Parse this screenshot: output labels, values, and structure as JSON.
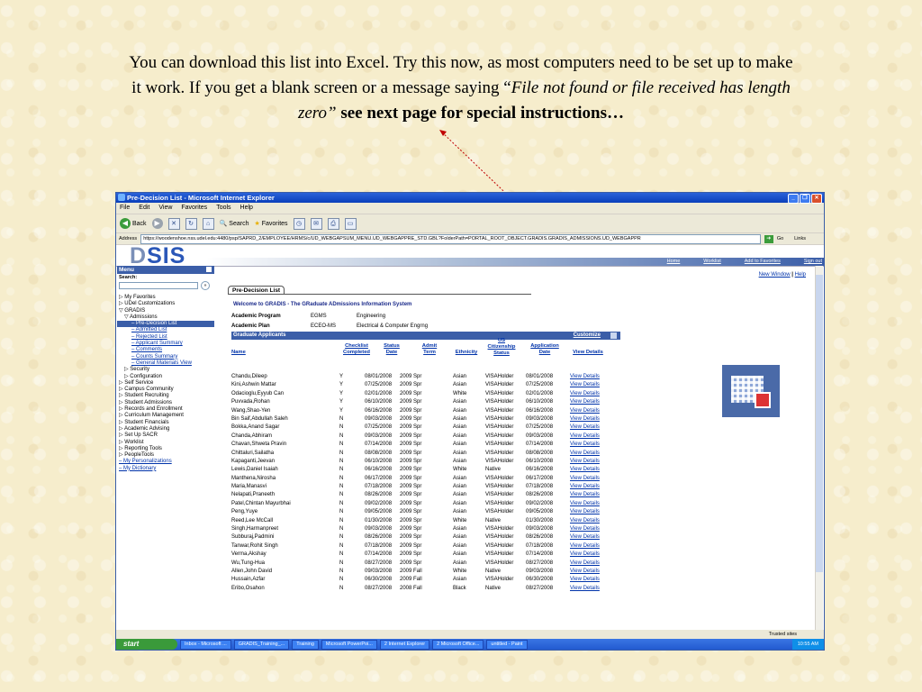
{
  "slide": {
    "line1": "You can download this list into Excel.  Try this now, as most computers need to be set up to make",
    "line2a": "it work.  If you get a blank screen or a message saying ",
    "quote_open": "“",
    "italic_a": "File not found or file received has length",
    "italic_b": "zero”",
    "bold": " see next page for special instructions…"
  },
  "window": {
    "title": "Pre-Decision List - Microsoft Internet Explorer",
    "menu": [
      "File",
      "Edit",
      "View",
      "Favorites",
      "Tools",
      "Help"
    ],
    "toolbar": {
      "back": "Back",
      "search": "Search",
      "favorites": "Favorites"
    },
    "address_label": "Address",
    "address": "https://woodenshoe.nss.udel.edu:4480/psp/SAPRD_2/EMPLOYEE/HRMS/c/UD_WEBGAPSUM_MENU.UD_WEBGAPPRE_STD.GBL?FolderPath=PORTAL_ROOT_OBJECT.GRADIS.GRADIS_ADMISSIONS.UD_WEBGAPPR",
    "go": "Go",
    "links": "Links"
  },
  "header": {
    "logo_a": "D",
    "logo_b": "SIS",
    "nav": [
      "Home",
      "Worklist",
      "Add to Favorites",
      "Sign out"
    ]
  },
  "sidebar": {
    "title": "Menu",
    "search_label": "Search:",
    "items": [
      {
        "label": "▷ My Favorites",
        "lvl": "l0"
      },
      {
        "label": "▷ UDel Customizations",
        "lvl": "l0"
      },
      {
        "label": "▽ GRADIS",
        "lvl": "l0"
      },
      {
        "label": "▽ Admissions",
        "lvl": "l1"
      },
      {
        "label": "– Pre-Decision List",
        "lvl": "l2 sel"
      },
      {
        "label": "– Admitted List",
        "lvl": "l2"
      },
      {
        "label": "– Rejected List",
        "lvl": "l2"
      },
      {
        "label": "– Applicant Summary",
        "lvl": "l2"
      },
      {
        "label": "– Comments",
        "lvl": "l2"
      },
      {
        "label": "– Counts Summary",
        "lvl": "l2"
      },
      {
        "label": "– General Materials View",
        "lvl": "l2"
      },
      {
        "label": "▷ Security",
        "lvl": "l1"
      },
      {
        "label": "▷ Configuration",
        "lvl": "l1"
      },
      {
        "label": "▷ Self Service",
        "lvl": "l0"
      },
      {
        "label": "▷ Campus Community",
        "lvl": "l0"
      },
      {
        "label": "▷ Student Recruiting",
        "lvl": "l0"
      },
      {
        "label": "▷ Student Admissions",
        "lvl": "l0"
      },
      {
        "label": "▷ Records and Enrollment",
        "lvl": "l0"
      },
      {
        "label": "▷ Curriculum Management",
        "lvl": "l0"
      },
      {
        "label": "▷ Student Financials",
        "lvl": "l0"
      },
      {
        "label": "▷ Academic Advising",
        "lvl": "l0"
      },
      {
        "label": "▷ Set Up SACR",
        "lvl": "l0"
      },
      {
        "label": "▷ Worklist",
        "lvl": "l0"
      },
      {
        "label": "▷ Reporting Tools",
        "lvl": "l0"
      },
      {
        "label": "▷ PeopleTools",
        "lvl": "l0"
      },
      {
        "label": "– My Personalizations",
        "lvl": "link"
      },
      {
        "label": "– My Dictionary",
        "lvl": "link"
      }
    ]
  },
  "content": {
    "new_window": "New Window",
    "sep": "|",
    "help": "Help",
    "tab": "Pre-Decision List",
    "welcome": "Welcome to GRADIS - The GRaduate ADmissions Information System",
    "program_label": "Academic Program",
    "program_code": "EGMS",
    "program_name": "Engineering",
    "plan_label": "Academic Plan",
    "plan_code": "ECEO-MS",
    "plan_name": "Electrical & Computer Engrng",
    "grid_title": "Graduate Applicants",
    "customize": "Customize",
    "columns": [
      "Name",
      "Checklist Completed",
      "Status Date",
      "Admit Term",
      "Ethnicity",
      "US Citizenship Status",
      "Application Date",
      "View Details"
    ],
    "rows": [
      [
        "Chandu,Dileep",
        "Y",
        "08/01/2008",
        "2009 Spr",
        "Asian",
        "VISAHolder",
        "08/01/2008",
        "View Details"
      ],
      [
        "Kini,Ashwin Mattar",
        "Y",
        "07/25/2008",
        "2009 Spr",
        "Asian",
        "VISAHolder",
        "07/25/2008",
        "View Details"
      ],
      [
        "Odacioglu,Eyyub Can",
        "Y",
        "02/01/2008",
        "2009 Spr",
        "White",
        "VISAHolder",
        "02/01/2008",
        "View Details"
      ],
      [
        "Puvvada,Rohan",
        "Y",
        "06/10/2008",
        "2009 Spr",
        "Asian",
        "VISAHolder",
        "06/10/2008",
        "View Details"
      ],
      [
        "Wang,Shao-Yen",
        "Y",
        "06/16/2008",
        "2009 Spr",
        "Asian",
        "VISAHolder",
        "06/16/2008",
        "View Details"
      ],
      [
        "Bin Saif,Abdullah Saleh",
        "N",
        "09/03/2008",
        "2009 Spr",
        "Asian",
        "VISAHolder",
        "09/03/2008",
        "View Details"
      ],
      [
        "Bokka,Anand Sagar",
        "N",
        "07/25/2008",
        "2009 Spr",
        "Asian",
        "VISAHolder",
        "07/25/2008",
        "View Details"
      ],
      [
        "Chanda,Abhiram",
        "N",
        "09/03/2008",
        "2009 Spr",
        "Asian",
        "VISAHolder",
        "09/03/2008",
        "View Details"
      ],
      [
        "Chavan,Shweta Pravin",
        "N",
        "07/14/2008",
        "2009 Spr",
        "Asian",
        "VISAHolder",
        "07/14/2008",
        "View Details"
      ],
      [
        "Chittaluri,Sailatha",
        "N",
        "08/08/2008",
        "2009 Spr",
        "Asian",
        "VISAHolder",
        "08/08/2008",
        "View Details"
      ],
      [
        "Kapaganti,Jeevan",
        "N",
        "06/10/2008",
        "2009 Spr",
        "Asian",
        "VISAHolder",
        "06/10/2008",
        "View Details"
      ],
      [
        "Lewis,Daniel Isaiah",
        "N",
        "06/16/2008",
        "2009 Spr",
        "White",
        "Native",
        "06/16/2008",
        "View Details"
      ],
      [
        "Manthena,Nirosha",
        "N",
        "06/17/2008",
        "2009 Spr",
        "Asian",
        "VISAHolder",
        "06/17/2008",
        "View Details"
      ],
      [
        "Maria,Manasvi",
        "N",
        "07/18/2008",
        "2009 Spr",
        "Asian",
        "VISAHolder",
        "07/18/2008",
        "View Details"
      ],
      [
        "Nelapati,Praneeth",
        "N",
        "08/26/2008",
        "2009 Spr",
        "Asian",
        "VISAHolder",
        "08/26/2008",
        "View Details"
      ],
      [
        "Patel,Chintan Mayurbhai",
        "N",
        "09/02/2008",
        "2009 Spr",
        "Asian",
        "VISAHolder",
        "09/02/2008",
        "View Details"
      ],
      [
        "Peng,Yuye",
        "N",
        "09/05/2008",
        "2009 Spr",
        "Asian",
        "VISAHolder",
        "09/05/2008",
        "View Details"
      ],
      [
        "Reed,Lee McCall",
        "N",
        "01/30/2008",
        "2009 Spr",
        "White",
        "Native",
        "01/30/2008",
        "View Details"
      ],
      [
        "Singh,Harmanpreet",
        "N",
        "09/03/2008",
        "2009 Spr",
        "Asian",
        "VISAHolder",
        "09/03/2008",
        "View Details"
      ],
      [
        "Subburaj,Padmini",
        "N",
        "08/26/2008",
        "2009 Spr",
        "Asian",
        "VISAHolder",
        "08/26/2008",
        "View Details"
      ],
      [
        "Tanwar,Rohit Singh",
        "N",
        "07/18/2008",
        "2009 Spr",
        "Asian",
        "VISAHolder",
        "07/18/2008",
        "View Details"
      ],
      [
        "Verma,Akshay",
        "N",
        "07/14/2008",
        "2009 Spr",
        "Asian",
        "VISAHolder",
        "07/14/2008",
        "View Details"
      ],
      [
        "Wu,Tung-Hua",
        "N",
        "08/27/2008",
        "2009 Spr",
        "Asian",
        "VISAHolder",
        "08/27/2008",
        "View Details"
      ],
      [
        "Allen,John David",
        "N",
        "09/03/2008",
        "2009 Fall",
        "White",
        "Native",
        "09/03/2008",
        "View Details"
      ],
      [
        "Hussain,Azfar",
        "N",
        "06/30/2008",
        "2009 Fall",
        "Asian",
        "VISAHolder",
        "06/30/2008",
        "View Details"
      ],
      [
        "Eribo,Osahon",
        "N",
        "08/27/2008",
        "2008 Fall",
        "Black",
        "Native",
        "08/27/2008",
        "View Details"
      ]
    ]
  },
  "statusbar": {
    "zone": "Trusted sites"
  },
  "taskbar": {
    "start": "start",
    "tasks": [
      "Inbox - Microsoft ...",
      "GRADIS_Training_...",
      "Training",
      "Microsoft PowerPoi...",
      "2 Internet Explorer",
      "2 Microsoft Office...",
      "untitled - Paint"
    ],
    "clock": "10:55 AM"
  },
  "colors": {
    "pointer": "#c00000",
    "header_blue": "#3b5ea8"
  }
}
